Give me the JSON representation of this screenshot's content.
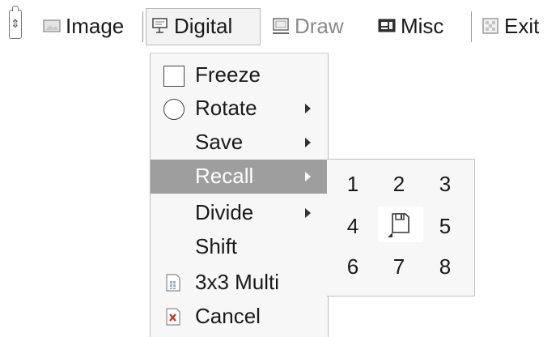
{
  "toolbar": {
    "items": [
      {
        "label": "Image",
        "icon": "image-icon",
        "enabled": true
      },
      {
        "label": "Digital",
        "icon": "digital-icon",
        "enabled": true,
        "active": true
      },
      {
        "label": "Draw",
        "icon": "draw-icon",
        "enabled": false
      },
      {
        "label": "Misc",
        "icon": "misc-icon",
        "enabled": true
      },
      {
        "label": "Exit",
        "icon": "exit-icon",
        "enabled": true
      }
    ],
    "grip_glyph": "⇕"
  },
  "menu": {
    "items": [
      {
        "label": "Freeze",
        "icon": "checkbox-icon",
        "submenu": false
      },
      {
        "label": "Rotate",
        "icon": "rotate-circle-icon",
        "submenu": true
      },
      {
        "label": "Save",
        "icon": "",
        "submenu": true
      },
      {
        "label": "Recall",
        "icon": "",
        "submenu": true,
        "selected": true
      },
      {
        "label": "Divide",
        "icon": "",
        "submenu": true
      },
      {
        "label": "Shift",
        "icon": "",
        "submenu": false
      },
      {
        "label": "3x3 Multi",
        "icon": "grid-document-icon",
        "submenu": false
      },
      {
        "label": "Cancel",
        "icon": "cancel-icon",
        "submenu": false
      }
    ]
  },
  "recall_submenu": {
    "cells": [
      "1",
      "2",
      "3",
      "4",
      "",
      "5",
      "6",
      "7",
      "8"
    ],
    "center_icon": "floppy-disk-icon"
  },
  "colors": {
    "selected_bg": "#9e9e9e",
    "menu_bg": "#f7f7f7",
    "text": "#1a1a1a",
    "disabled_text": "#8a8a8a"
  }
}
